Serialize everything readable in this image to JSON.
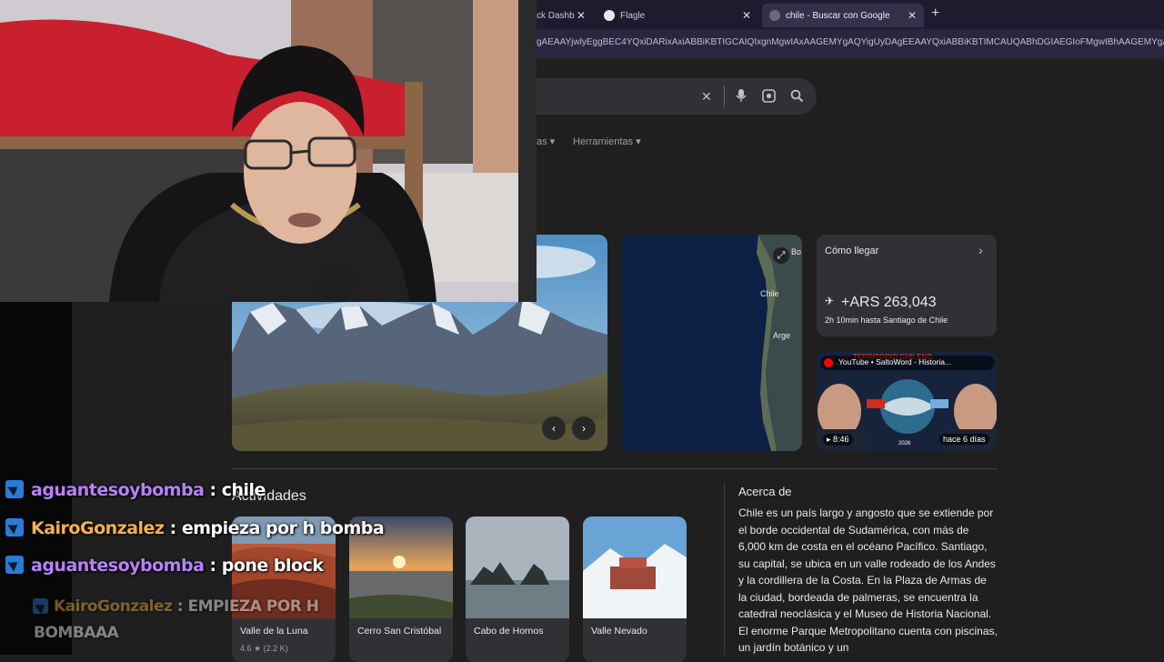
{
  "browser": {
    "tabs": [
      {
        "label": "ck Dashb"
      },
      {
        "label": "Flagle"
      },
      {
        "label": "chile - Buscar con Google"
      }
    ],
    "new_tab": "+",
    "close": "✕",
    "url": "gAEAAYjwlyEggBEC4YQxiDARixAxiABBiKBTIGCAIQIxgnMgwIAxAAGEMYgAQYigUyDAgEEAAYQxiABBiKBTIMCAUQABhDGIAEGIoFMgwIBhAAGEMYgA"
  },
  "search": {
    "tabs_partial": "as",
    "tools": "Herramientas"
  },
  "map": {
    "labels": [
      "Chile",
      "Arge",
      "Bo"
    ]
  },
  "directions": {
    "title": "Cómo llegar",
    "price": "+ARS 263,043",
    "detail": "2h 10min hasta Santiago de Chile"
  },
  "video": {
    "source": "YouTube • SaltoWord - Historia...",
    "duration": "8:46",
    "age": "hace 6 días",
    "banner": "TERRITORIO CHILENO",
    "year": "2026"
  },
  "section": {
    "heading": "Actividades"
  },
  "places": [
    {
      "name": "Valle de la Luna",
      "rating": "4.6 ★ (2.2 K)"
    },
    {
      "name": "Cerro San Cristóbal",
      "rating": ""
    },
    {
      "name": "Cabo de Hornos",
      "rating": ""
    },
    {
      "name": "Valle Nevado",
      "rating": ""
    }
  ],
  "about": {
    "title": "Acerca de",
    "text": "Chile es un país largo y angosto que se extiende por el borde occidental de Sudamérica, con más de 6,000 km de costa en el océano Pacífico. Santiago, su capital, se ubica en un valle rodeado de los Andes y la cordillera de la Costa. En la Plaza de Armas de la ciudad, bordeada de palmeras, se encuentra la catedral neoclásica y el Museo de Historia Nacional. El enorme Parque Metropolitano cuenta con piscinas, un jardín botánico y un"
  },
  "chat": [
    {
      "user": "aguantesoybomba",
      "sep": " : ",
      "message": "chile",
      "color": "#b880ff"
    },
    {
      "user": "KairoGonzalez",
      "sep": " : ",
      "message": "empieza por h bomba",
      "color": "#f5b24a"
    },
    {
      "user": "aguantesoybomba",
      "sep": " : ",
      "message": "pone block",
      "color": "#b880ff"
    },
    {
      "user": "KairoGonzalez",
      "sep": " : ",
      "message": "EMPIEZA POR H",
      "message2": "BOMBAAA",
      "color": "#f5b24a"
    }
  ]
}
